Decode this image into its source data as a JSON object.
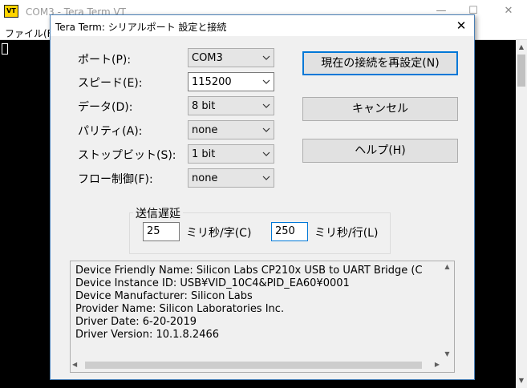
{
  "background_window": {
    "title": "COM3 - Tera Term VT",
    "app_icon_text": "VT",
    "menu_file": "ファイル(F)",
    "minimize": "—",
    "maximize": "☐",
    "close": "✕"
  },
  "dialog": {
    "title": "Tera Term: シリアルポート 設定と接続",
    "close": "✕",
    "fields": {
      "port": {
        "label": "ポート(P):",
        "value": "COM3"
      },
      "speed": {
        "label": "スピード(E):",
        "value": "115200"
      },
      "data": {
        "label": "データ(D):",
        "value": "8 bit"
      },
      "parity": {
        "label": "パリティ(A):",
        "value": "none"
      },
      "stopbits": {
        "label": "ストップビット(S):",
        "value": "1 bit"
      },
      "flow": {
        "label": "フロー制御(F):",
        "value": "none"
      }
    },
    "buttons": {
      "reconnect": "現在の接続を再設定(N)",
      "cancel": "キャンセル",
      "help": "ヘルプ(H)"
    },
    "delay": {
      "title": "送信遅延",
      "char_value": "25",
      "char_label": "ミリ秒/字(C)",
      "line_value": "250",
      "line_label": "ミリ秒/行(L)"
    },
    "info_lines": [
      "Device Friendly Name: Silicon Labs CP210x USB to UART Bridge (C",
      "Device Instance ID: USB¥VID_10C4&PID_EA60¥0001",
      "Device Manufacturer: Silicon Labs",
      "Provider Name: Silicon Laboratories Inc.",
      "Driver Date: 6-20-2019",
      "Driver Version: 10.1.8.2466"
    ]
  }
}
